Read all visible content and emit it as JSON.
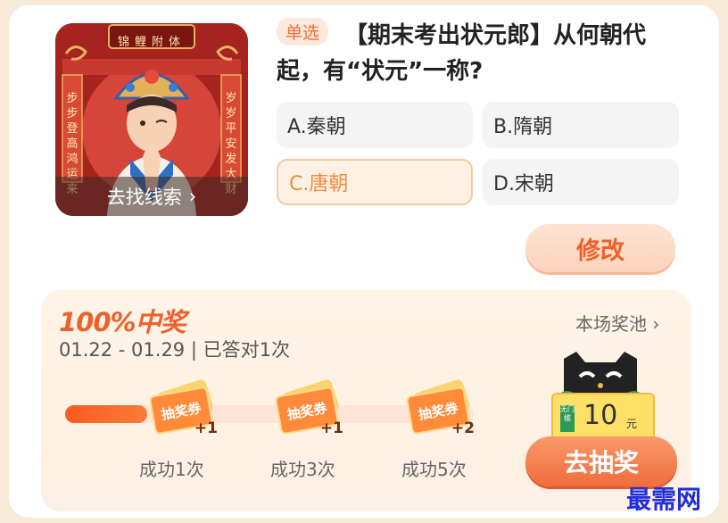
{
  "question": {
    "tag": "单选",
    "text": "【期末考出状元郎】从何朝代起，有“状元”一称?",
    "thumbnail_banner": "去找线索",
    "thumbnail_plaque": "锦鲤附体",
    "thumbnail_left_scroll": "步步登高鸿运来",
    "thumbnail_right_scroll": "岁岁平安发大财",
    "options": [
      {
        "label": "A.秦朝",
        "selected": false
      },
      {
        "label": "B.隋朝",
        "selected": false
      },
      {
        "label": "C.唐朝",
        "selected": true
      },
      {
        "label": "D.宋朝",
        "selected": false
      }
    ],
    "modify_label": "修改"
  },
  "prize": {
    "title": "100%中奖",
    "dates": "01.22 - 01.29 | 已答对1次",
    "pool_label": "本场奖池",
    "progress_fraction": 0.2,
    "ticket_text": "抽奖券",
    "steps": [
      {
        "label": "成功1次",
        "plus": "+1"
      },
      {
        "label": "成功3次",
        "plus": "+1"
      },
      {
        "label": "成功5次",
        "plus": "+2"
      }
    ],
    "coupon_tag": "无门槛",
    "coupon_value": "10",
    "coupon_unit": "元",
    "draw_label": "去抽奖"
  },
  "watermark": "最需网",
  "colors": {
    "accent": "#f0602b",
    "selected_border": "#f7c8a0",
    "progress": "#ff5a1e"
  }
}
